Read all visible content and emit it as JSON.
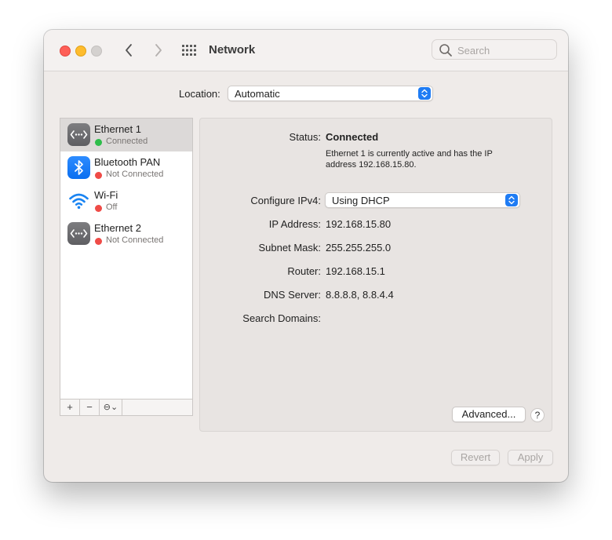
{
  "window": {
    "title": "Network"
  },
  "search": {
    "placeholder": "Search"
  },
  "location": {
    "label": "Location:",
    "value": "Automatic"
  },
  "services": [
    {
      "name": "Ethernet 1",
      "status": "Connected",
      "status_color": "#2fbd4b",
      "icon": "ethernet-icon",
      "selected": true
    },
    {
      "name": "Bluetooth PAN",
      "status": "Not Connected",
      "status_color": "#ef4b47",
      "icon": "bluetooth-icon"
    },
    {
      "name": "Wi-Fi",
      "status": "Off",
      "status_color": "#ef4b47",
      "icon": "wifi-icon"
    },
    {
      "name": "Ethernet 2",
      "status": "Not Connected",
      "status_color": "#ef4b47",
      "icon": "ethernet-icon"
    }
  ],
  "sidebar_toolbar": {
    "add": "+",
    "remove": "−",
    "action": "⊖⌄"
  },
  "detail": {
    "status_label": "Status:",
    "status_value": "Connected",
    "status_desc": "Ethernet 1 is currently active and has the IP address 192.168.15.80.",
    "configure_label": "Configure IPv4:",
    "configure_value": "Using DHCP",
    "ip_label": "IP Address:",
    "ip_value": "192.168.15.80",
    "subnet_label": "Subnet Mask:",
    "subnet_value": "255.255.255.0",
    "router_label": "Router:",
    "router_value": "192.168.15.1",
    "dns_label": "DNS Server:",
    "dns_value": "8.8.8.8, 8.8.4.4",
    "search_domains_label": "Search Domains:",
    "search_domains_value": ""
  },
  "buttons": {
    "advanced": "Advanced...",
    "help": "?",
    "revert": "Revert",
    "apply": "Apply"
  },
  "colors": {
    "accent": "#1f7cf4"
  }
}
